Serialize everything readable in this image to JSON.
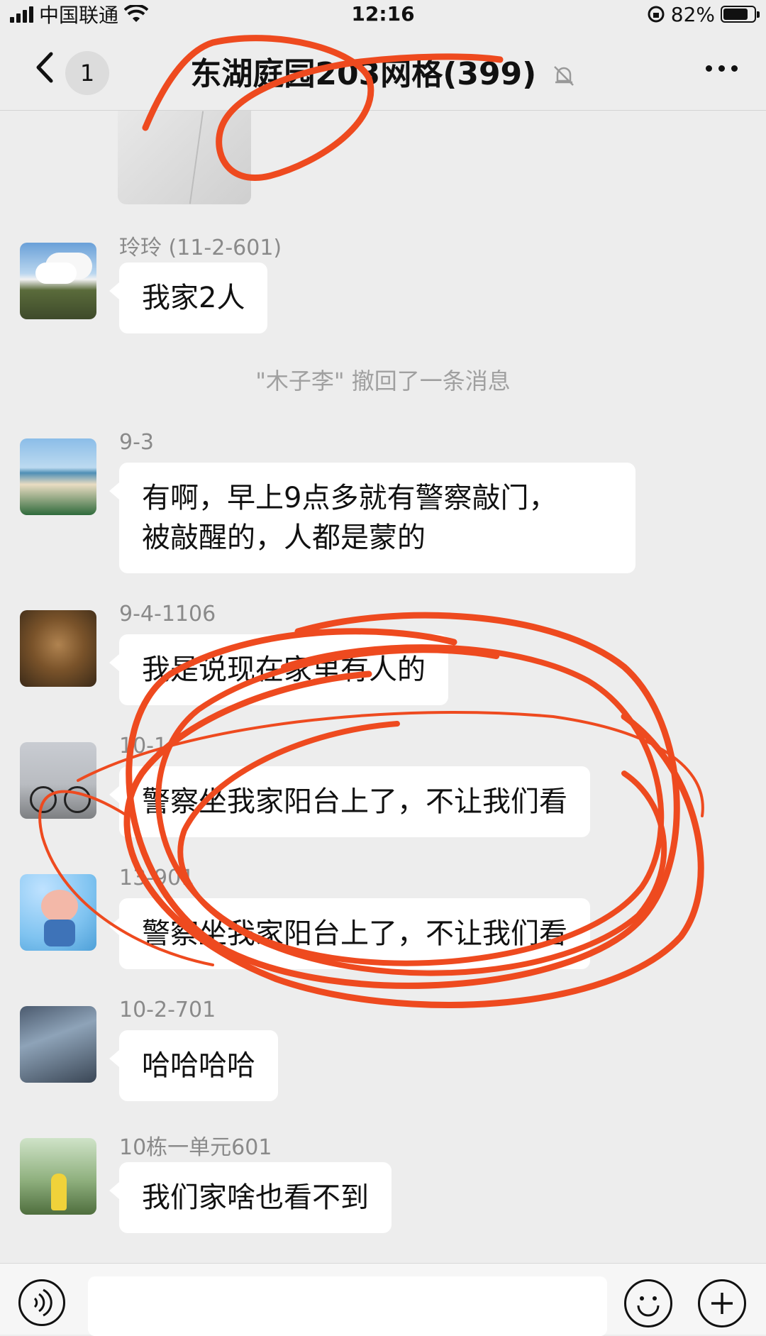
{
  "status_bar": {
    "carrier": "中国联通",
    "time": "12:16",
    "battery_percent": "82%",
    "battery_level": 0.82
  },
  "nav": {
    "back_icon": "chevron-left-icon",
    "unread_count": "1",
    "title": "东湖庭园",
    "title_obscured": "203网格(399)",
    "muted_icon": "bell-slash-icon",
    "more_icon": "ellipsis-icon"
  },
  "messages": [
    {
      "sender": "玲玲 (11-2-601)",
      "text": "我家2人"
    },
    {
      "sender": "9-3",
      "text_line1": "有啊，早上9点多就有警察敲门，",
      "text_line2": "被敲醒的，人都是蒙的"
    },
    {
      "sender": "9-4-1106",
      "text": "我是说现在家里有人的"
    },
    {
      "sender": "10-1",
      "text": "警察坐我家阳台上了，不让我们看"
    },
    {
      "sender": "13-901",
      "text": "警察坐我家阳台上了，不让我们看"
    },
    {
      "sender": "10-2-701",
      "text": "哈哈哈哈"
    },
    {
      "sender": "10栋一单元601",
      "text": "我们家啥也看不到"
    }
  ],
  "system_note": "\"木子李\" 撤回了一条消息",
  "input_bar": {
    "voice_icon": "voice-icon",
    "emoji_icon": "smile-icon",
    "plus_icon": "plus-circle-icon"
  },
  "colors": {
    "background": "#ededed",
    "bubble": "#ffffff",
    "annotation": "#ee4a1f"
  }
}
